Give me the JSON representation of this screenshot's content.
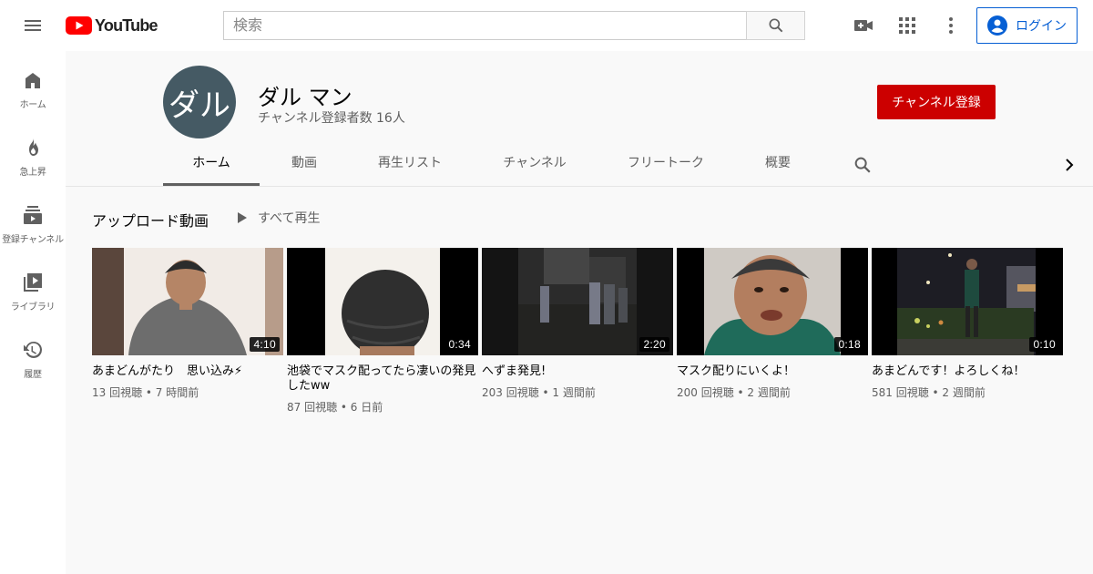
{
  "header": {
    "logo_text": "YouTube",
    "search_placeholder": "検索",
    "login_label": "ログイン"
  },
  "sidebar": {
    "items": [
      {
        "label": "ホーム",
        "icon": "home-icon"
      },
      {
        "label": "急上昇",
        "icon": "fire-icon"
      },
      {
        "label": "登録チャンネル",
        "icon": "subscriptions-icon"
      },
      {
        "label": "ライブラリ",
        "icon": "library-icon"
      },
      {
        "label": "履歴",
        "icon": "history-icon"
      }
    ]
  },
  "channel": {
    "avatar_text": "ダル",
    "name": "ダル マン",
    "subscribers": "チャンネル登録者数 16人",
    "subscribe_label": "チャンネル登録",
    "tabs": [
      "ホーム",
      "動画",
      "再生リスト",
      "チャンネル",
      "フリートーク",
      "概要"
    ]
  },
  "uploads": {
    "title": "アップロード動画",
    "play_all": "すべて再生",
    "videos": [
      {
        "title": "あまどんがたり　思い込み⚡",
        "meta": "13 回視聴 • 7 時間前",
        "duration": "4:10"
      },
      {
        "title": "池袋でマスク配ってたら凄いの発見したww",
        "meta": "87 回視聴 • 6 日前",
        "duration": "0:34"
      },
      {
        "title": "へずま発見!",
        "meta": "203 回視聴 • 1 週間前",
        "duration": "2:20"
      },
      {
        "title": "マスク配りにいくよ！",
        "meta": "200 回視聴 • 2 週間前",
        "duration": "0:18"
      },
      {
        "title": "あまどんです！よろしくね！",
        "meta": "581 回視聴 • 2 週間前",
        "duration": "0:10"
      }
    ]
  },
  "colors": {
    "brand_red": "#ff0000",
    "subscribe_red": "#cc0000",
    "link_blue": "#065fd4",
    "avatar_bg": "#455a64"
  }
}
